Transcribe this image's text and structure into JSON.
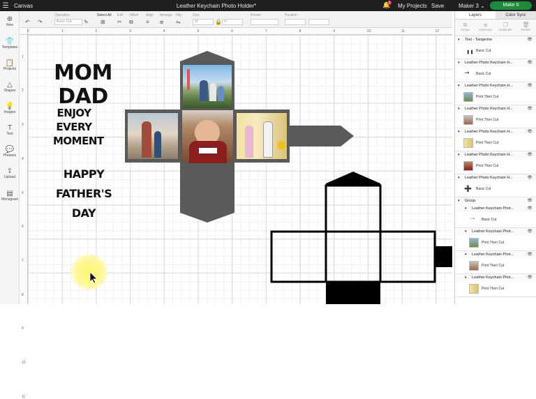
{
  "topbar": {
    "app": "Canvas",
    "title": "Leather Keychain Photo Holder*",
    "badge": "1",
    "my_projects": "My Projects",
    "save": "Save",
    "machine": "Maker 3",
    "make_it": "Make It"
  },
  "toolbar": {
    "items": [
      "Operation",
      "Select All",
      "Edit",
      "Offset",
      "Align",
      "Arrange",
      "Flip",
      "Size",
      "Rotate",
      "Position"
    ],
    "operation_value": "Basic Cut",
    "size_w": "W",
    "size_h": "H"
  },
  "leftbar": {
    "items": [
      "New",
      "Templates",
      "Projects",
      "Shapes",
      "Images",
      "Text",
      "Phrases",
      "Upload",
      "Monogram"
    ]
  },
  "ruler": {
    "h": [
      "0",
      "1",
      "2",
      "3",
      "4",
      "5",
      "6",
      "7",
      "8",
      "9",
      "10",
      "11",
      "12",
      "13",
      "14",
      "15",
      "16",
      "17",
      "18",
      "19",
      "20",
      "21",
      "22"
    ],
    "v": [
      "1",
      "2",
      "3",
      "4",
      "5",
      "6",
      "7",
      "8",
      "9",
      "10",
      "11"
    ]
  },
  "canvas": {
    "text1": "MOM DAD",
    "text2": [
      "ENJOY",
      "EVERY",
      "MOMENT"
    ],
    "text3": [
      "HAPPY",
      "FATHER'S",
      "DAY"
    ],
    "colors": {
      "template_gray": "#5a5a5a",
      "photo_border": "#555555",
      "cut_black": "#000000"
    }
  },
  "panel": {
    "tabs": [
      "Layers",
      "Color Sync"
    ],
    "tools": [
      "Group",
      "UnGroup",
      "Duplicate",
      "Delete"
    ],
    "layers": [
      {
        "name": "Text - Tangerine",
        "sub": "Basic Cut"
      },
      {
        "name": "Leather Photo Keychain H...",
        "sub": "Basic Cut"
      },
      {
        "name": "Leather Photo Keychain H...",
        "sub": "Print Then Cut"
      },
      {
        "name": "Leather Photo Keychain H...",
        "sub": "Print Then Cut"
      },
      {
        "name": "Leather Photo Keychain H...",
        "sub": "Print Then Cut"
      },
      {
        "name": "Leather Photo Keychain H...",
        "sub": "Print Then Cut"
      },
      {
        "name": "Leather Photo Keychain H...",
        "sub": "Basic Cut"
      }
    ],
    "group": {
      "name": "Group",
      "children": [
        {
          "name": "Leather Keychain Phot...",
          "sub": "Basic Cut"
        },
        {
          "name": "Leather Keychain Phot...",
          "sub": "Print Then Cut"
        },
        {
          "name": "Leather Keychain Phot...",
          "sub": "Print Then Cut"
        },
        {
          "name": "Leather Keychain Phot...",
          "sub": "Print Then Cut"
        }
      ]
    }
  }
}
